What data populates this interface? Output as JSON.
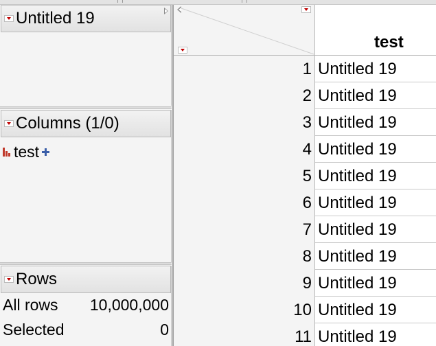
{
  "table_panel": {
    "title": "Untitled 19"
  },
  "columns_panel": {
    "title": "Columns (1/0)",
    "items": [
      {
        "name": "test",
        "icon": "continuous-column-icon"
      }
    ]
  },
  "rows_panel": {
    "title": "Rows",
    "stats": [
      {
        "label": "All rows",
        "value": "10,000,000"
      },
      {
        "label": "Selected",
        "value": "0"
      }
    ]
  },
  "grid": {
    "column_header": "test",
    "rows": [
      {
        "n": "1",
        "value": "Untitled 19"
      },
      {
        "n": "2",
        "value": "Untitled 19"
      },
      {
        "n": "3",
        "value": "Untitled 19"
      },
      {
        "n": "4",
        "value": "Untitled 19"
      },
      {
        "n": "5",
        "value": "Untitled 19"
      },
      {
        "n": "6",
        "value": "Untitled 19"
      },
      {
        "n": "7",
        "value": "Untitled 19"
      },
      {
        "n": "8",
        "value": "Untitled 19"
      },
      {
        "n": "9",
        "value": "Untitled 19"
      },
      {
        "n": "10",
        "value": "Untitled 19"
      },
      {
        "n": "11",
        "value": "Untitled 19"
      }
    ]
  },
  "colors": {
    "disclosure_red": "#c00000",
    "panel_bg": "#f4f4f4",
    "plus_blue": "#3a5ea8"
  }
}
